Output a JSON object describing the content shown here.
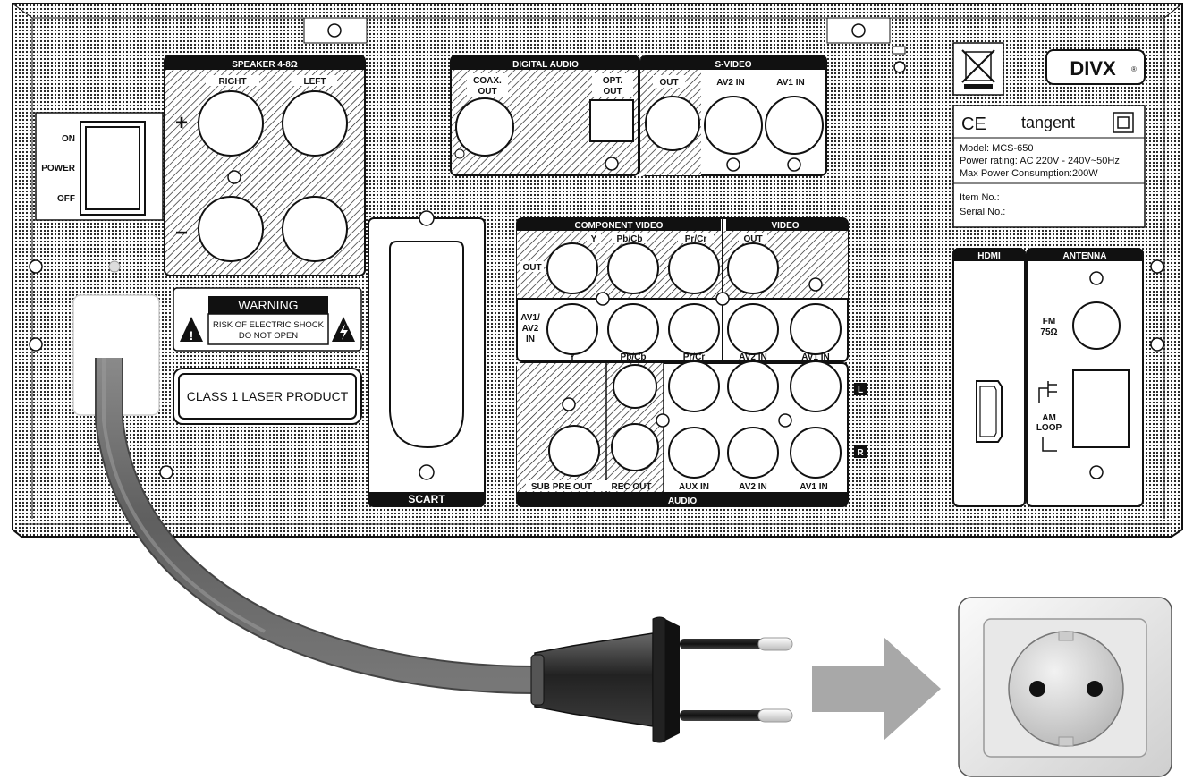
{
  "speaker": {
    "header": "SPEAKER 4-8Ω",
    "right": "RIGHT",
    "left": "LEFT",
    "plus": "+",
    "minus": "−"
  },
  "power": {
    "on": "ON",
    "power": "POWER",
    "off": "OFF"
  },
  "digital_audio": {
    "header": "DIGITAL AUDIO",
    "coax1": "COAX.",
    "coax2": "OUT",
    "opt1": "OPT.",
    "opt2": "OUT"
  },
  "svideo": {
    "header": "S-VIDEO",
    "out": "OUT",
    "av2": "AV2 IN",
    "av1": "AV1 IN"
  },
  "warning": {
    "title": "WARNING",
    "line1": "RISK OF ELECTRIC SHOCK",
    "line2": "DO NOT OPEN"
  },
  "laser": "CLASS 1 LASER PRODUCT",
  "scart": "SCART",
  "component_video": {
    "header": "COMPONENT VIDEO",
    "y": "Y",
    "pb": "Pb/Cb",
    "pr": "Pr/Cr",
    "out": "OUT",
    "av_in1": "AV1/",
    "av_in2": "AV2",
    "av_in3": "IN"
  },
  "video": {
    "header": "VIDEO",
    "out": "OUT",
    "av2": "AV2 IN",
    "av1": "AV1 IN"
  },
  "audio": {
    "header": "AUDIO",
    "sub": "SUB PRE OUT",
    "rec": "REC OUT",
    "aux": "AUX IN",
    "av2": "AV2 IN",
    "av1": "AV1 IN",
    "l": "L",
    "r": "R"
  },
  "rating": {
    "brand": "tangent",
    "ce": "CE",
    "model": "Model: MCS-650",
    "power": "Power rating: AC 220V - 240V~50Hz",
    "max": "Max Power Consumption:200W",
    "item": "Item No.:",
    "serial": "Serial No.:"
  },
  "divx": "DIVX",
  "hdmi": "HDMI",
  "antenna": {
    "header": "ANTENNA",
    "fm1": "FM",
    "fm2": "75Ω",
    "am1": "AM",
    "am2": "LOOP"
  }
}
